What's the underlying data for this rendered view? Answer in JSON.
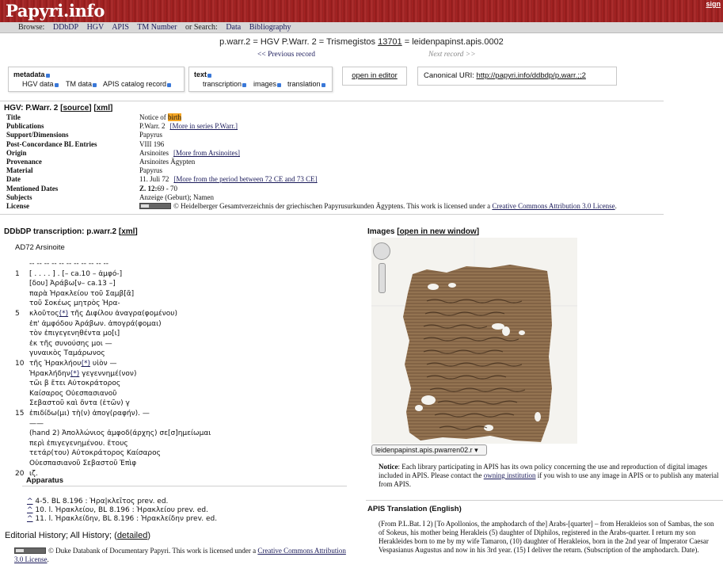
{
  "header": {
    "site_title": "Papyri.info",
    "sign_in": "sign"
  },
  "nav": {
    "browse_label": "Browse:",
    "items": [
      "DDbDP",
      "HGV",
      "APIS",
      "TM Number"
    ],
    "search_label": "or Search:",
    "search_items": [
      "Data",
      "Bibliography"
    ]
  },
  "record": {
    "identifiers_prefix": "p.warr.2 = HGV P.Warr. 2 = Trismegistos ",
    "tm_number": "13701",
    "identifiers_suffix": " = leidenpapinst.apis.0002",
    "prev": "<< Previous record",
    "next": "Next record >>"
  },
  "controls": {
    "metadata": {
      "label": "metadata",
      "options": [
        "HGV data",
        "TM data",
        "APIS catalog record"
      ]
    },
    "text": {
      "label": "text",
      "options": [
        "transcription",
        "images",
        "translation"
      ]
    },
    "open_editor": "open in editor",
    "canonical_label": "Canonical URI:",
    "canonical_uri": "http://papyri.info/ddbdp/p.warr.;;2"
  },
  "hgv": {
    "title": "HGV: P.Warr. 2",
    "source_link": "source",
    "xml_link": "xml",
    "rows": [
      {
        "key": "Title",
        "value": "Notice of ",
        "highlight": "birth"
      },
      {
        "key": "Publications",
        "value": "P.Warr. 2",
        "link": "[More in series P.Warr.]"
      },
      {
        "key": "Support/Dimensions",
        "value": "Papyrus"
      },
      {
        "key": "Post-Concordance BL Entries",
        "value": "VIII 196"
      },
      {
        "key": "Origin",
        "value": "Arsinoites",
        "link": "[More from Arsinoites]"
      },
      {
        "key": "Provenance",
        "value": "Arsinoites Ägypten"
      },
      {
        "key": "Material",
        "value": "Papyrus"
      },
      {
        "key": "Date",
        "value": "11. Juli 72",
        "link": "[More from the period between 72 CE and 73 CE]"
      },
      {
        "key": "Mentioned Dates",
        "value_bold": "Z. 12:",
        "value": "69 - 70"
      },
      {
        "key": "Subjects",
        "value": "Anzeige (Geburt); Namen"
      },
      {
        "key": "License",
        "value": "© Heidelberger Gesamtverzeichnis der griechischen Papyrusurkunden Ägyptens. This work is licensed under a ",
        "link": "Creative Commons Attribution 3.0 License",
        "after": "."
      }
    ]
  },
  "ddbdp": {
    "title": "DDbDP transcription: p.warr.2",
    "xml_link": "xml",
    "place": "AD72 Arsinoite",
    "lines": [
      {
        "n": "",
        "t": "-- -- -- -- -- -- -- -- -- -- --"
      },
      {
        "n": "1",
        "t": "[ . . . . ] . [– ca.10 – ἀμφό-]"
      },
      {
        "n": "",
        "t": "[δου] Ἀράβω[ν– ca.13 –]"
      },
      {
        "n": "",
        "t": "παρὰ Ἡρακλείου τοῦ Σαμβ[ᾶ]"
      },
      {
        "n": "",
        "t": "τοῦ Σοκέως μητρὸς Ἡρα-"
      },
      {
        "n": "5",
        "t": "κλοῦτος",
        "u": "(*)",
        "t2": " τῆς Διφίλου ἀναγρα(φομένου)"
      },
      {
        "n": "",
        "t": "ἐπ' ἀμφόδου Ἀράβων. ἀπογρά(φομαι)"
      },
      {
        "n": "",
        "t": "τὸν ἐπιγεγενηθέντα μο[ι]"
      },
      {
        "n": "",
        "t": "ἐκ τῆς συνούσης μοι —"
      },
      {
        "n": "",
        "t": "γυναικὸς Ταμάρωνος"
      },
      {
        "n": "10",
        "t": "τῆς Ἡρακλήου",
        "u": "(*)",
        "t2": " υἱὸν —"
      },
      {
        "n": "",
        "t": "Ἡρακλήδην",
        "u": "(*)",
        "t2": " γεγεννημέ(νον)"
      },
      {
        "n": "",
        "t": "τῶι β ἔτει Αὐτοκράτορος"
      },
      {
        "n": "",
        "t": "Καίσαρος Οὐεσπασιανοῦ"
      },
      {
        "n": "",
        "t": "Σεβαστοῦ καὶ ὄντα (ἐτῶν) γ"
      },
      {
        "n": "15",
        "t": "ἐπιδίδω(μι) τὴ(ν) ἀπογ(ραφήν). —"
      },
      {
        "n": "",
        "t": "——"
      },
      {
        "n": "",
        "t": "(hand 2) Ἀπολλώνιος ἀμφοδ(άρχης) σε[σ]ημείωμαι"
      },
      {
        "n": "",
        "t": "περὶ ἐπιγεγενημένου. ἔτους"
      },
      {
        "n": "",
        "t": "τετάρ(του) Αὐτοκράτορος Καίσαρος"
      },
      {
        "n": "",
        "t": "Οὐεσπασιανοῦ Σεβαστοῦ Ἐπὶφ"
      },
      {
        "n": "20",
        "t": "ιζ."
      }
    ],
    "apparatus_title": "Apparatus",
    "apparatus": [
      {
        "mark": "^",
        "t": " 4-5. BL 8.196 : Ἡρα|κλεῖτος prev. ed."
      },
      {
        "mark": "^",
        "t": " 10. l. Ἡρακλείου, BL 8.196 : Ἡρακλείου prev. ed."
      },
      {
        "mark": "^",
        "t": " 11. l. Ἡρακλείδην, BL 8.196 : Ἡρακλείδην prev. ed."
      }
    ],
    "history_label": "Editorial History; All History; (",
    "history_link": "detailed",
    "history_end": ")",
    "license_text": "© Duke Databank of Documentary Papyri. This work is licensed under a ",
    "license_link": "Creative Commons Attribution 3.0 License",
    "license_end": "."
  },
  "images": {
    "title": "Images",
    "new_window_link": "open in new window",
    "selected_image": "leidenpapinst.apis.pwarren02.r",
    "notice_bold": "Notice",
    "notice_text": ": Each library participating in APIS has its own policy concerning the use and reproduction of digital images included in APIS. Please contact the ",
    "notice_link": "owning institution",
    "notice_end": " if you wish to use any image in APIS or to publish any material from APIS."
  },
  "apis": {
    "title": "APIS Translation (English)",
    "text": "(From P.L.Bat. I 2) [To Apollonios, the amphodarch of the] Arabs-[quarter] – from Herakleios son of Sambas, the son of Sokeus, his mother being Herakleis (5) daughter of Diphilos, registered in the Arabs-quarter. I return my son Herakleides born to me by my wife Tamaron, (10) daughter of Herakleios, born in the 2nd year of Imperator Caesar Vespasianus Augustus and now in his 3rd year. (15) I deliver the return. (Subscription of the amphodarch. Date)."
  },
  "colors": {
    "header_red": "#9e1e1e",
    "nav_grey": "#d8d8d8",
    "highlight": "#f5a623",
    "link": "#1a1a8c"
  }
}
